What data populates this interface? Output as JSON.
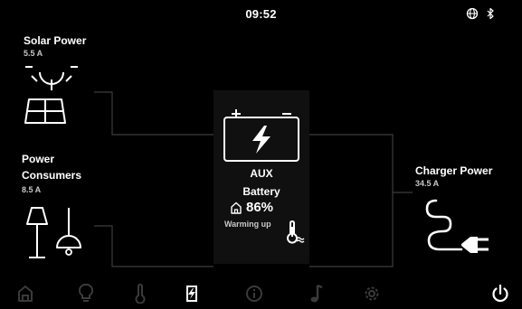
{
  "status_bar": {
    "time": "09:52",
    "icons": [
      "globe-icon",
      "bluetooth-icon"
    ]
  },
  "solar": {
    "title": "Solar Power",
    "current": "5.5 A",
    "icons": [
      "sun-icon",
      "solar-panel-icon"
    ]
  },
  "consumers": {
    "title_line1": "Power",
    "title_line2": "Consumers",
    "current": "8.5 A",
    "icons": [
      "floor-lamp-icon",
      "ceiling-lamp-icon"
    ]
  },
  "battery": {
    "line1": "AUX",
    "line2": "Battery",
    "percent": "86%",
    "status": "Warming up",
    "icons": [
      "battery-bolt-icon",
      "home-icon",
      "thermometer-icon"
    ]
  },
  "charger": {
    "title": "Charger Power",
    "current": "34.5 A",
    "icons": [
      "plug-icon"
    ]
  },
  "nav": {
    "active": "energy",
    "items": [
      "home",
      "light",
      "temperature",
      "energy",
      "info",
      "music",
      "settings",
      "power"
    ]
  },
  "colors": {
    "background": "#000000",
    "text": "#ffffff",
    "subtext": "#c8c8c8",
    "inactive_nav": "#3a3a3a",
    "connector": "#3c3c3c",
    "panel": "#101010"
  }
}
